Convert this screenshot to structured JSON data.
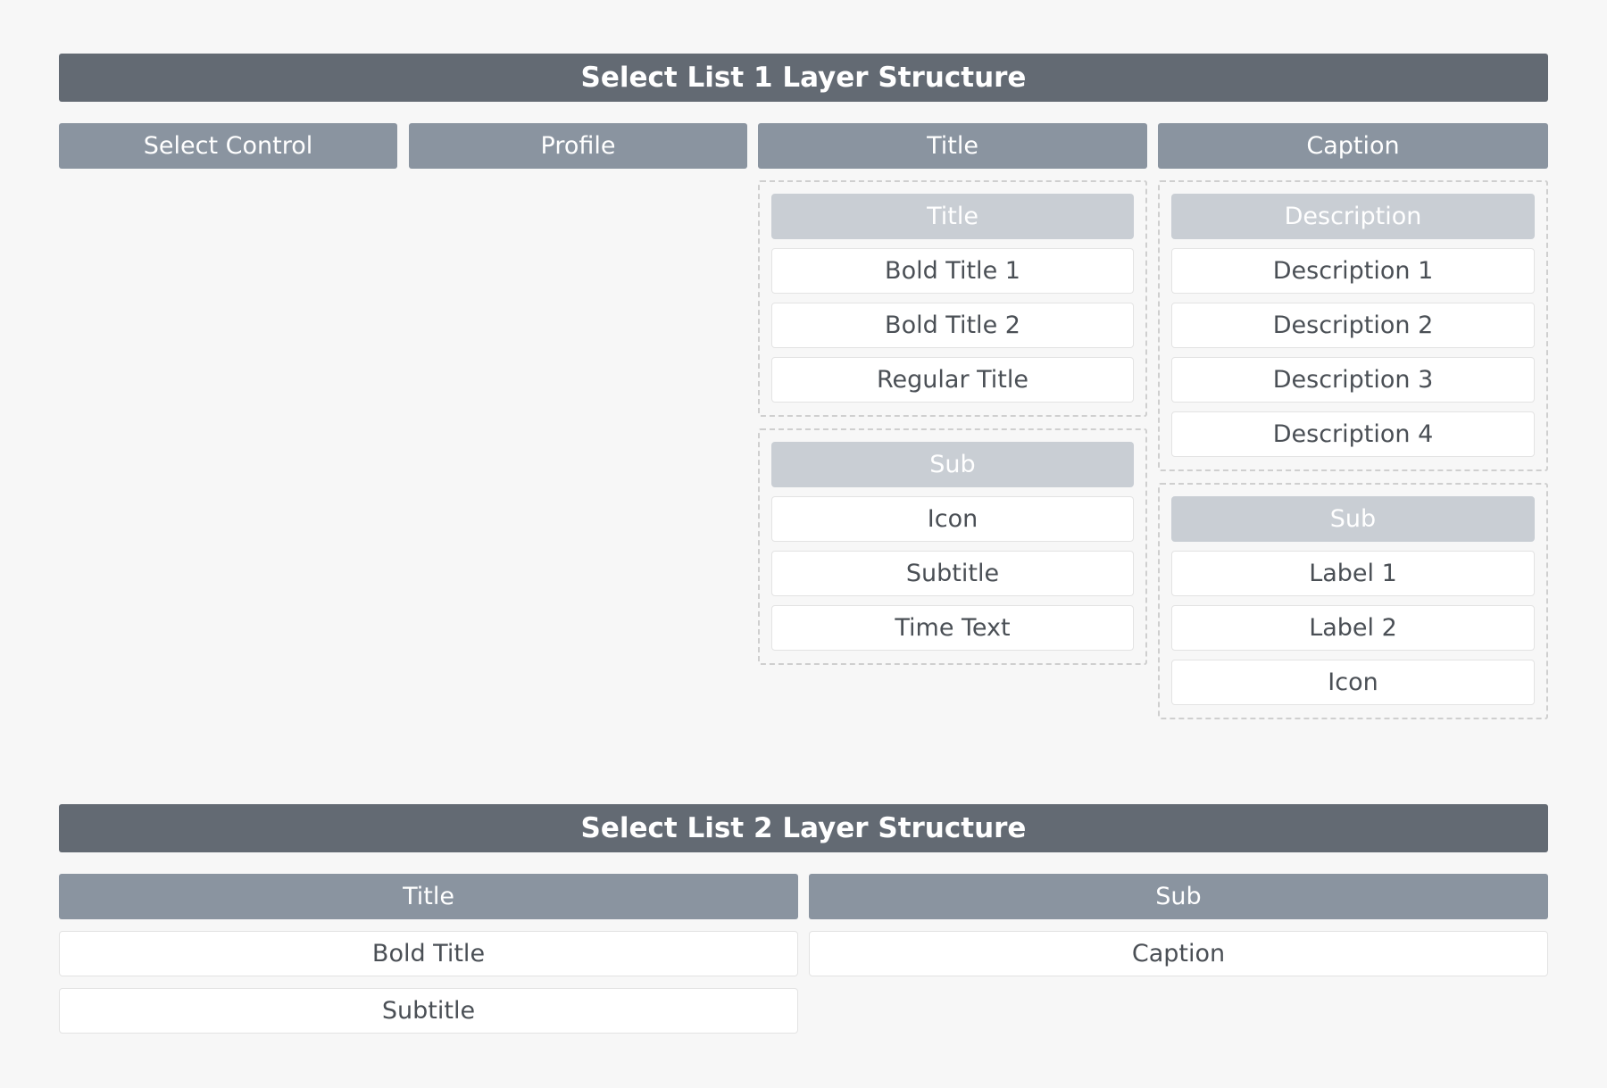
{
  "list1": {
    "title": "Select List 1 Layer Structure",
    "columns": [
      "Select Control",
      "Profile",
      "Title",
      "Caption"
    ],
    "title_groups": [
      {
        "header": "Title",
        "items": [
          "Bold Title 1",
          "Bold Title 2",
          "Regular Title"
        ]
      },
      {
        "header": "Sub",
        "items": [
          "Icon",
          "Subtitle",
          "Time Text"
        ]
      }
    ],
    "caption_groups": [
      {
        "header": "Description",
        "items": [
          "Description 1",
          "Description 2",
          "Description 3",
          "Description 4"
        ]
      },
      {
        "header": "Sub",
        "items": [
          "Label 1",
          "Label 2",
          "Icon"
        ]
      }
    ]
  },
  "list2": {
    "title": "Select List 2 Layer Structure",
    "columns": [
      "Title",
      "Sub"
    ],
    "title_items": [
      "Bold Title",
      "Subtitle"
    ],
    "sub_items": [
      "Caption"
    ]
  },
  "colors": {
    "background": "#f7f7f7",
    "section_title": "#636a73",
    "column_header": "#8a94a0",
    "sub_header": "#c9ced4",
    "item": "#ffffff",
    "item_text": "#4a4f55"
  }
}
